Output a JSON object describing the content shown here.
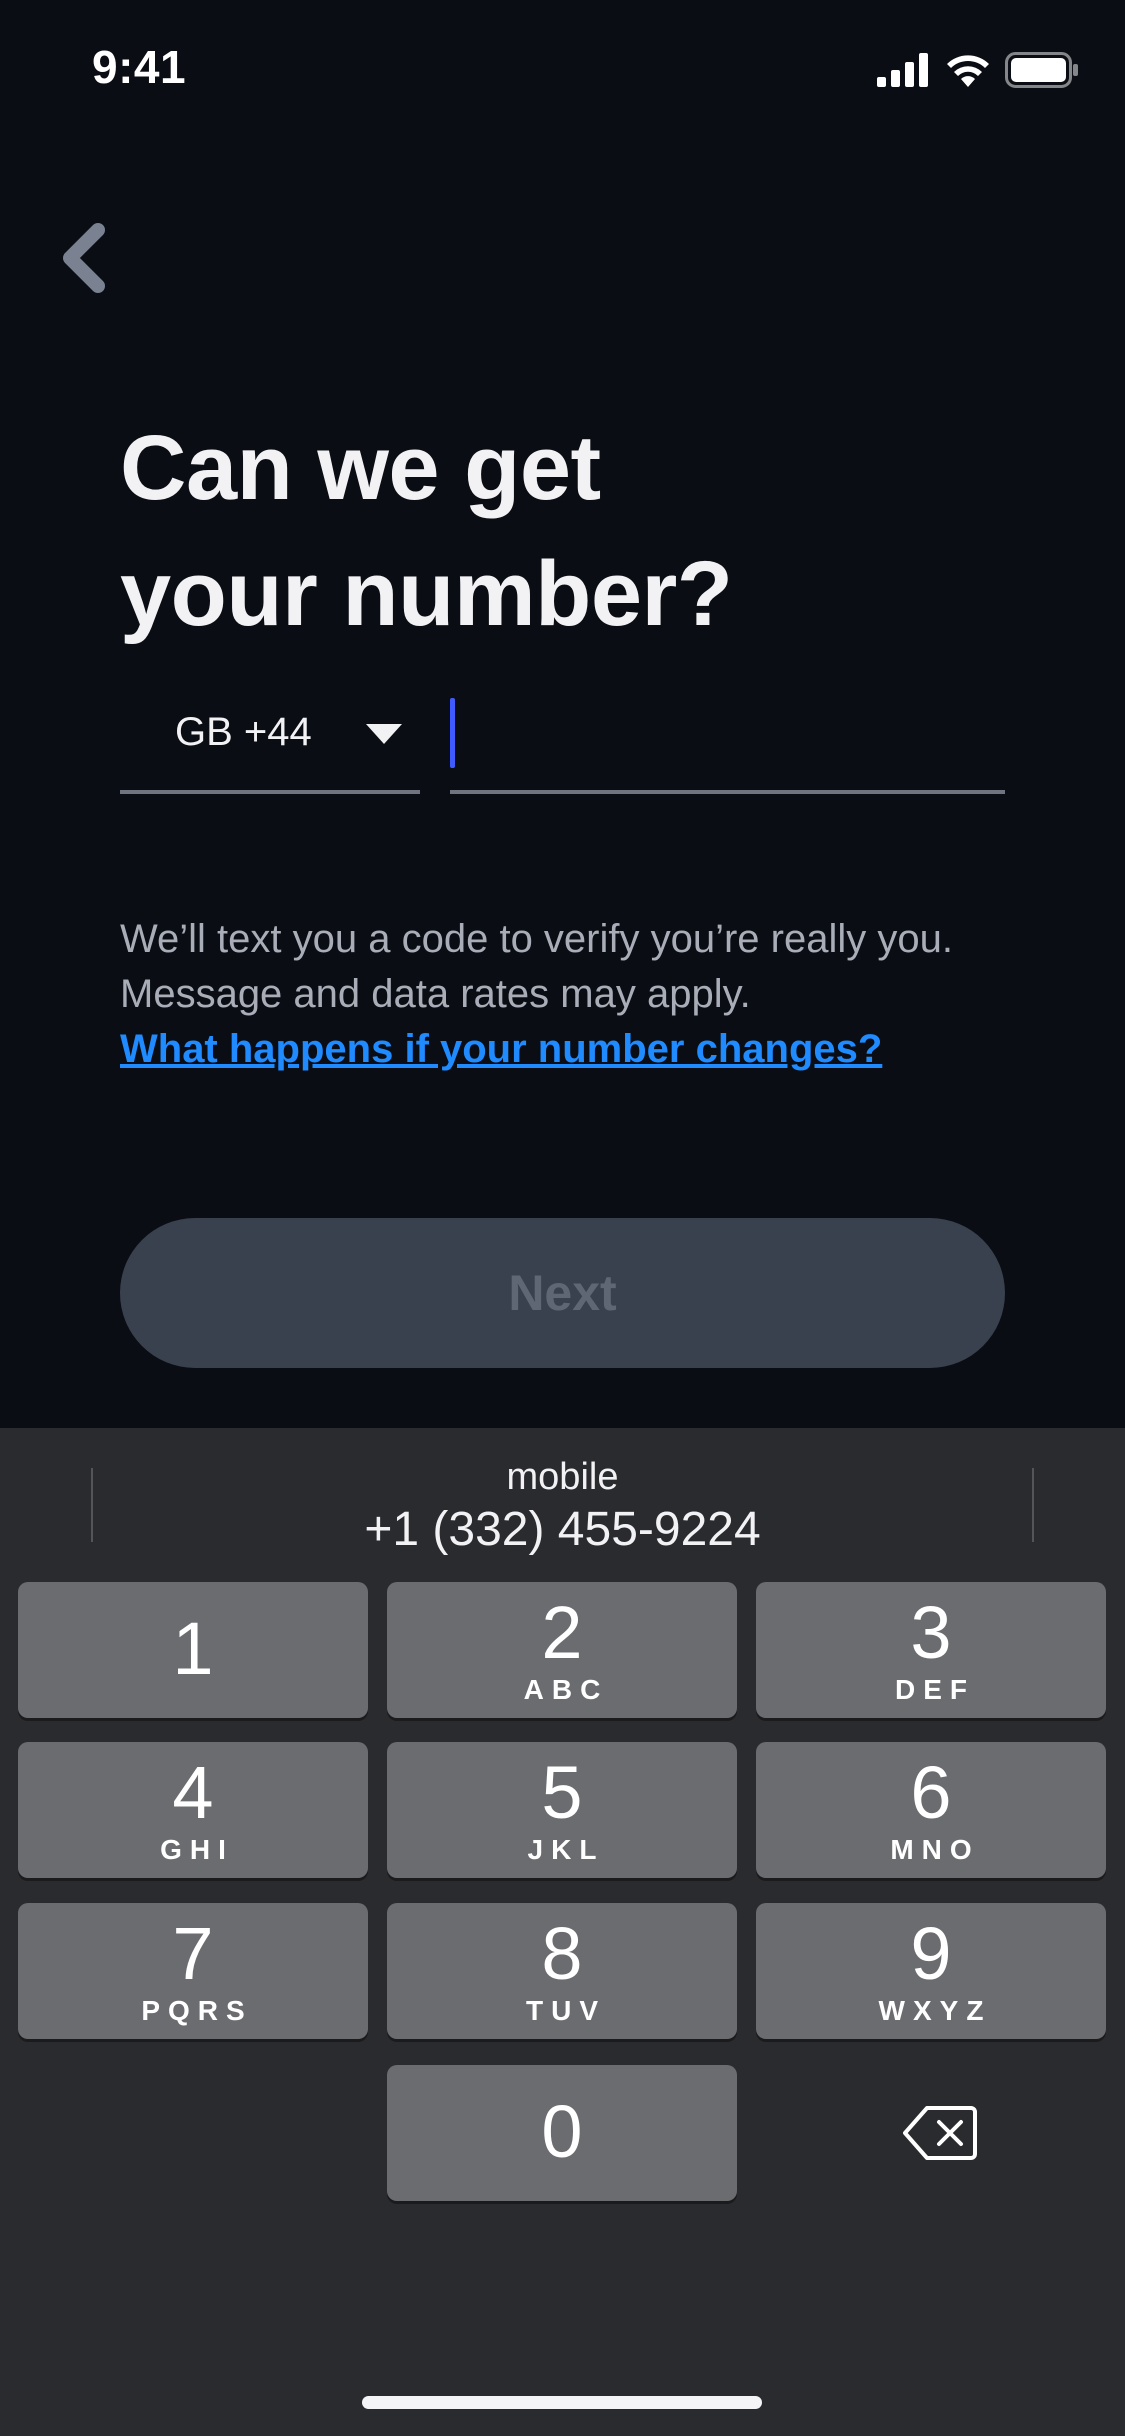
{
  "status_bar": {
    "time": "9:41"
  },
  "header": {
    "title_line1": "Can we get",
    "title_line2": "your number?"
  },
  "phone_form": {
    "country_code_label": "GB +44",
    "phone_value": "",
    "phone_placeholder": ""
  },
  "info": {
    "text": "We’ll text you a code to verify you’re really you. Message and data rates may apply.",
    "link_text": "What happens if your number changes?"
  },
  "actions": {
    "next_label": "Next"
  },
  "keyboard": {
    "suggestion_label": "mobile",
    "suggestion_number": "+1 (332) 455-9224",
    "keys": [
      {
        "digit": "1",
        "letters": ""
      },
      {
        "digit": "2",
        "letters": "ABC"
      },
      {
        "digit": "3",
        "letters": "DEF"
      },
      {
        "digit": "4",
        "letters": "GHI"
      },
      {
        "digit": "5",
        "letters": "JKL"
      },
      {
        "digit": "6",
        "letters": "MNO"
      },
      {
        "digit": "7",
        "letters": "PQRS"
      },
      {
        "digit": "8",
        "letters": "TUV"
      },
      {
        "digit": "9",
        "letters": "WXYZ"
      },
      {
        "digit": "0",
        "letters": ""
      }
    ]
  },
  "colors": {
    "background": "#0a0d13",
    "accent_link": "#1f8bff",
    "cursor": "#3f5bff",
    "button_disabled": "#3a414e",
    "keyboard_bg": "#2a2b2e",
    "key_bg": "#6b6c6f"
  },
  "icons": [
    "signal-icon",
    "wifi-icon",
    "battery-icon",
    "back-chevron-icon",
    "dropdown-caret-icon",
    "delete-icon"
  ]
}
